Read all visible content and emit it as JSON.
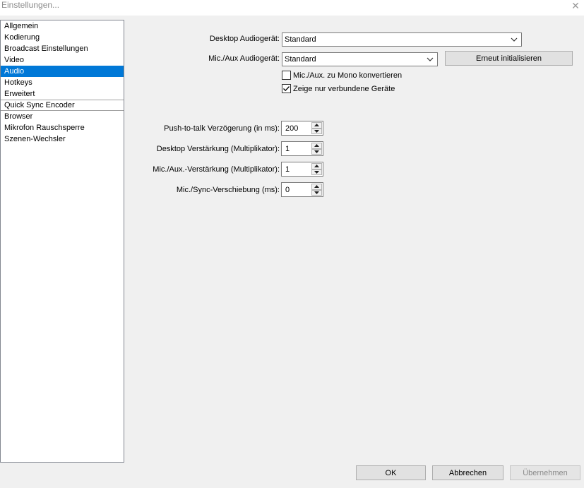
{
  "window": {
    "title": "Einstellungen..."
  },
  "sidebar": {
    "items": [
      {
        "label": "Allgemein"
      },
      {
        "label": "Kodierung"
      },
      {
        "label": "Broadcast Einstellungen"
      },
      {
        "label": "Video"
      },
      {
        "label": "Audio"
      },
      {
        "label": "Hotkeys"
      },
      {
        "label": "Erweitert"
      },
      {
        "label": "Quick Sync Encoder"
      },
      {
        "label": "Browser"
      },
      {
        "label": "Mikrofon Rauschsperre"
      },
      {
        "label": "Szenen-Wechsler"
      }
    ],
    "selected": "Audio"
  },
  "audio": {
    "desktop_device": {
      "label": "Desktop Audiogerät:",
      "value": "Standard"
    },
    "mic_device": {
      "label": "Mic./Aux Audiogerät:",
      "value": "Standard"
    },
    "reinit_button": "Erneut initialisieren",
    "mono_checkbox": {
      "label": "Mic./Aux. zu Mono konvertieren",
      "checked": false
    },
    "connected_checkbox": {
      "label": "Zeige nur verbundene Geräte",
      "checked": true
    },
    "push_to_talk": {
      "label": "Push-to-talk Verzögerung (in ms):",
      "value": "200"
    },
    "desktop_gain": {
      "label": "Desktop Verstärkung (Multiplikator):",
      "value": "1"
    },
    "mic_gain": {
      "label": "Mic./Aux.-Verstärkung (Multiplikator):",
      "value": "1"
    },
    "mic_sync": {
      "label": "Mic./Sync-Verschiebung (ms):",
      "value": "0"
    }
  },
  "footer": {
    "ok": "OK",
    "cancel": "Abbrechen",
    "apply": "Übernehmen"
  },
  "colors": {
    "selection": "#0078d7",
    "background": "#f0f0f0"
  }
}
